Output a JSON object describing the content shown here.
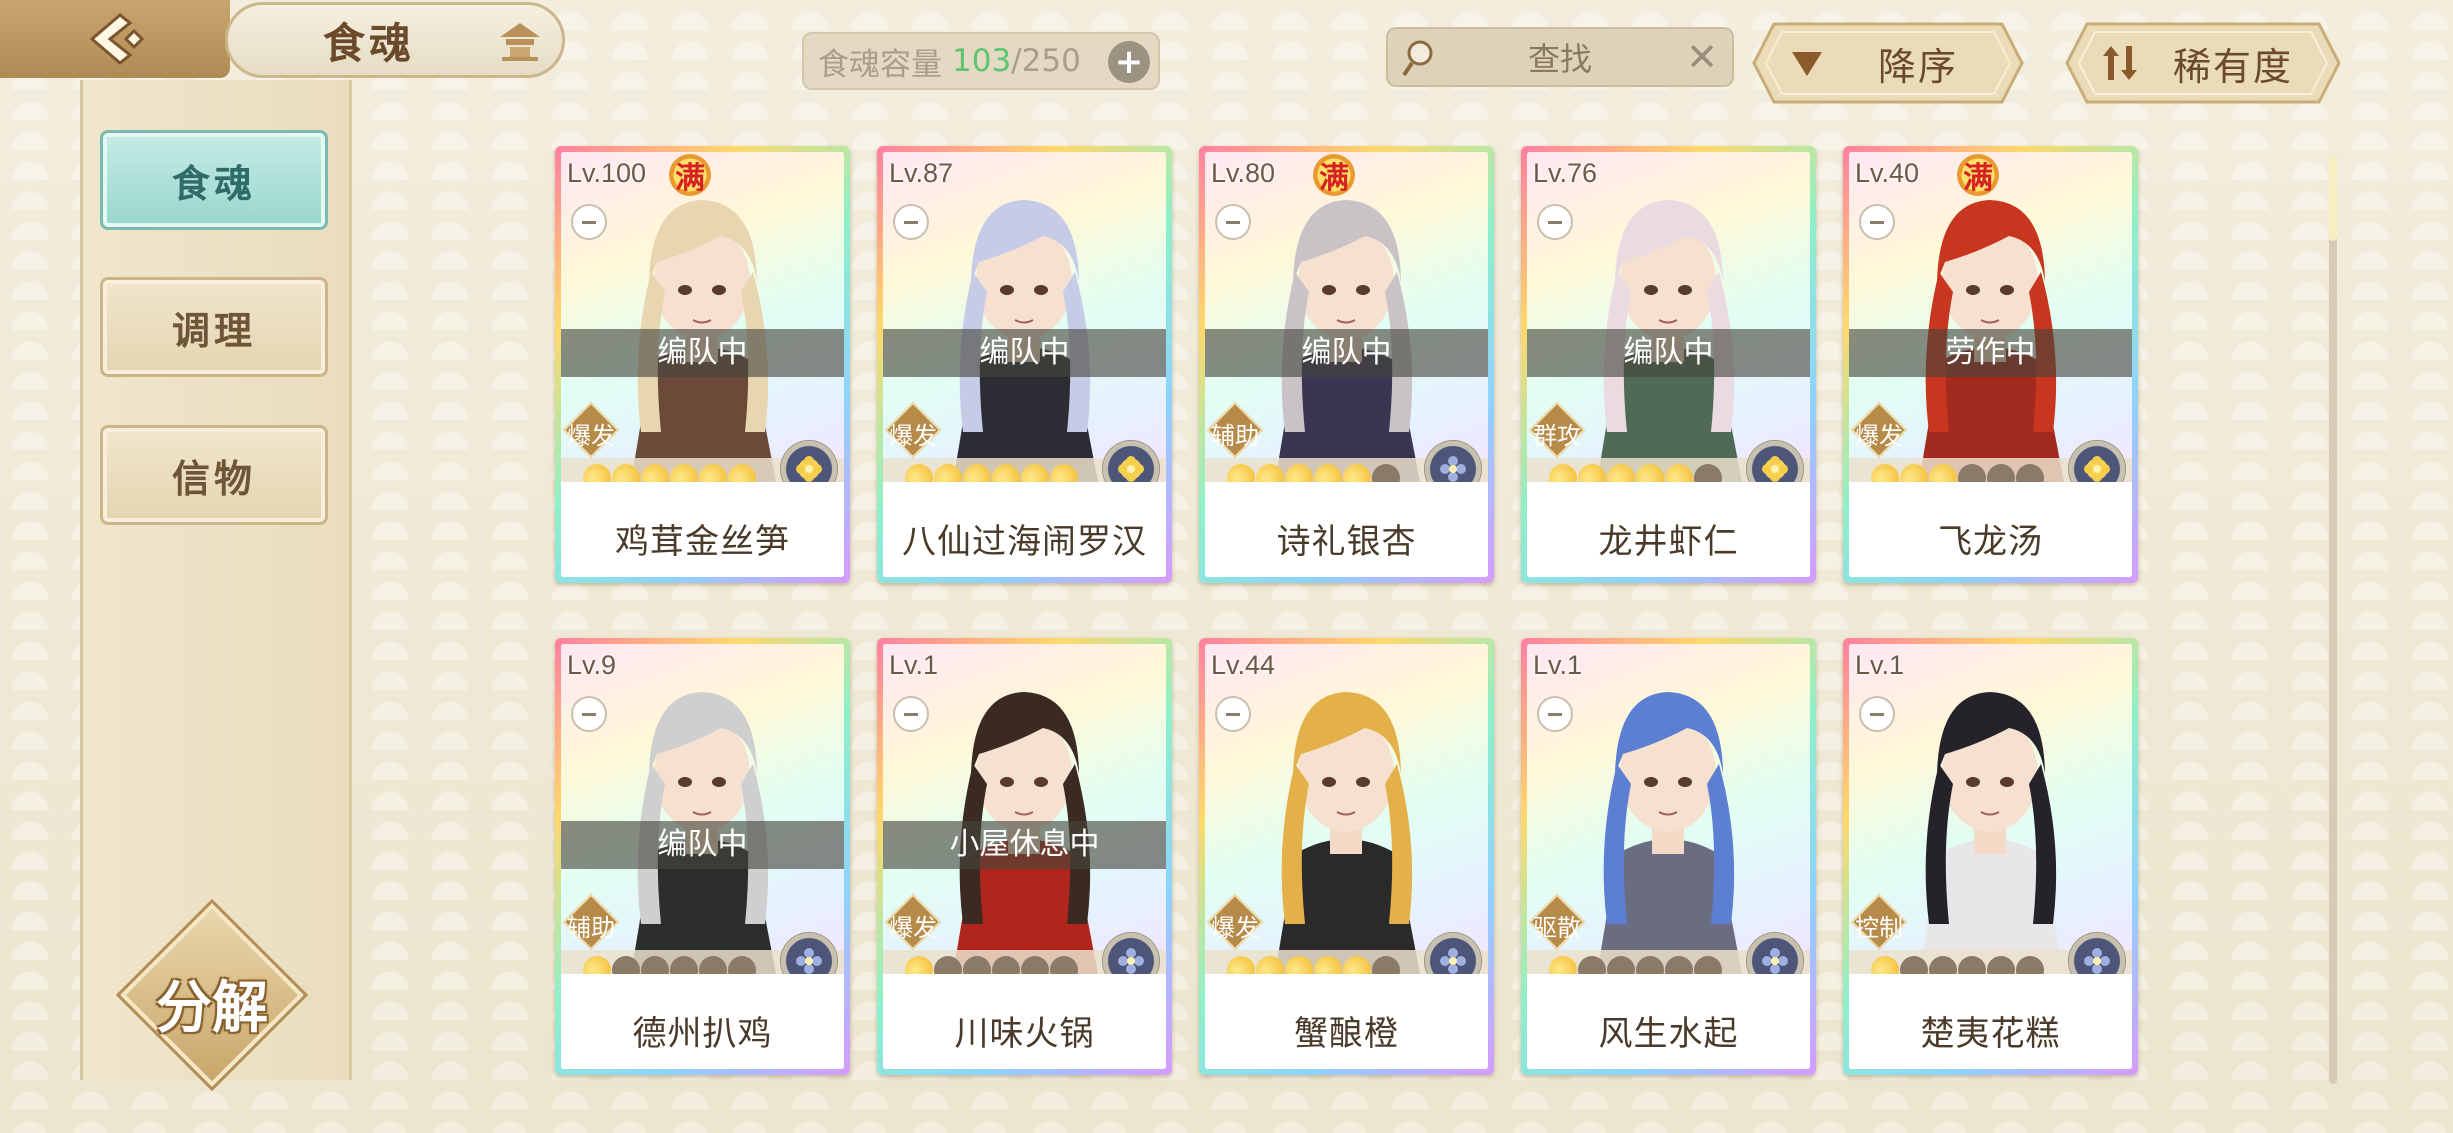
{
  "header": {
    "title": "食魂",
    "capacity_label": "食魂容量",
    "capacity_current": "103",
    "capacity_sep_max": "/250",
    "search_placeholder": "查找",
    "sort_order": "降序",
    "sort_by": "稀有度"
  },
  "sidebar": {
    "tabs": [
      {
        "label": "食魂",
        "active": true
      },
      {
        "label": "调理",
        "active": false
      },
      {
        "label": "信物",
        "active": false
      }
    ],
    "decompose_label": "分解"
  },
  "cards": [
    {
      "level": "Lv.100",
      "full": "满",
      "status": "编队中",
      "role": "爆发",
      "stars_on": 6,
      "name": "鸡茸金丝笋",
      "element": "gold",
      "hair": "#e8d6b0",
      "outfit": "#6b4a3a"
    },
    {
      "level": "Lv.87",
      "full": "",
      "status": "编队中",
      "role": "爆发",
      "stars_on": 6,
      "name": "八仙过海闹罗汉",
      "element": "gold",
      "hair": "#c6cbe8",
      "outfit": "#2c2c34"
    },
    {
      "level": "Lv.80",
      "full": "满",
      "status": "编队中",
      "role": "辅助",
      "stars_on": 5,
      "name": "诗礼银杏",
      "element": "blue",
      "hair": "#c9c3c8",
      "outfit": "#3a3550"
    },
    {
      "level": "Lv.76",
      "full": "",
      "status": "编队中",
      "role": "群攻",
      "stars_on": 5,
      "name": "龙井虾仁",
      "element": "gold",
      "hair": "#eadbe2",
      "outfit": "#4f6a55"
    },
    {
      "level": "Lv.40",
      "full": "满",
      "status": "劳作中",
      "role": "爆发",
      "stars_on": 3,
      "name": "飞龙汤",
      "element": "gold",
      "hair": "#c8361f",
      "outfit": "#a22a1f"
    },
    {
      "level": "Lv.9",
      "full": "",
      "status": "编队中",
      "role": "辅助",
      "stars_on": 1,
      "name": "德州扒鸡",
      "element": "blue",
      "hair": "#cfcfcf",
      "outfit": "#2a2d2a"
    },
    {
      "level": "Lv.1",
      "full": "",
      "status": "小屋休息中",
      "role": "爆发",
      "stars_on": 1,
      "name": "川味火锅",
      "element": "blue",
      "hair": "#3a2a22",
      "outfit": "#b0261c"
    },
    {
      "level": "Lv.44",
      "full": "",
      "status": "",
      "role": "爆发",
      "stars_on": 5,
      "name": "蟹酿橙",
      "element": "blue",
      "hair": "#e3b04a",
      "outfit": "#2a2a2a"
    },
    {
      "level": "Lv.1",
      "full": "",
      "status": "",
      "role": "驱散",
      "stars_on": 1,
      "name": "风生水起",
      "element": "blue",
      "hair": "#5d7fd1",
      "outfit": "#6a6c82"
    },
    {
      "level": "Lv.1",
      "full": "",
      "status": "",
      "role": "控制",
      "stars_on": 1,
      "name": "楚夷花糕",
      "element": "blue",
      "hair": "#25222a",
      "outfit": "#e8e6e8"
    }
  ]
}
